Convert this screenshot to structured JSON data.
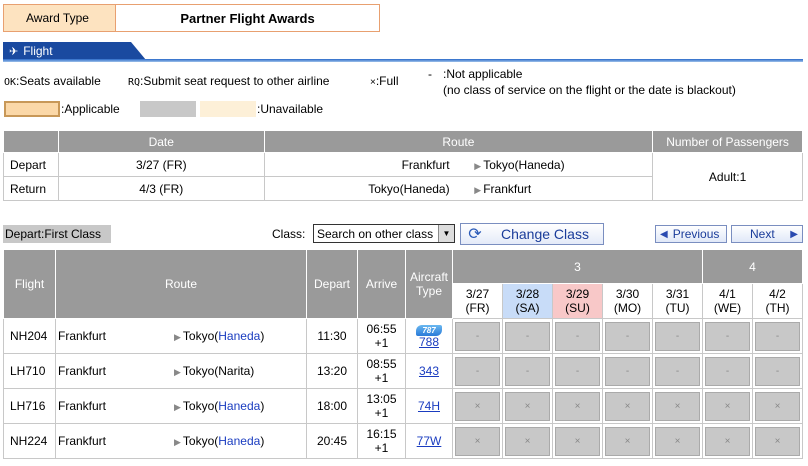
{
  "award": {
    "label": "Award Type",
    "value": "Partner Flight Awards"
  },
  "section": {
    "flight_tab": "Flight"
  },
  "legend": {
    "ok_code": "OK",
    "ok_text": ":Seats available",
    "rq_code": "RQ",
    "rq_text": ":Submit seat request to other airline",
    "full_code": "×",
    "full_text": ":Full",
    "na_code": "-",
    "na_text": ":Not applicable",
    "na_note": "(no class of service on the flight or the date is blackout)",
    "applicable": ":Applicable",
    "unavailable": ":Unavailable",
    "colors": {
      "applicable": "#fbd8a8",
      "unavailable_gray": "#c8c8c8",
      "unavailable_cream": "#fdf0d8"
    }
  },
  "summary": {
    "headers": {
      "date": "Date",
      "route": "Route",
      "passengers": "Number of Passengers"
    },
    "depart": {
      "label": "Depart",
      "date": "3/27 (FR)",
      "from": "Frankfurt",
      "to": "Tokyo(Haneda)"
    },
    "return": {
      "label": "Return",
      "date": "4/3 (FR)",
      "from": "Tokyo(Haneda)",
      "to": "Frankfurt"
    },
    "passengers": "Adult:1"
  },
  "controls": {
    "depart_label": "Depart:First Class",
    "class_label": "Class:",
    "class_value": "Search on other class",
    "change_class": "Change Class",
    "previous": "Previous",
    "next": "Next"
  },
  "flights_table": {
    "headers": {
      "flight": "Flight",
      "route": "Route",
      "depart": "Depart",
      "arrive": "Arrive",
      "aircraft1": "Aircraft",
      "aircraft2": "Type",
      "month3": "3",
      "month4": "4"
    },
    "dates": [
      {
        "d": "3/27",
        "w": "(FR)"
      },
      {
        "d": "3/28",
        "w": "(SA)"
      },
      {
        "d": "3/29",
        "w": "(SU)"
      },
      {
        "d": "3/30",
        "w": "(MO)"
      },
      {
        "d": "3/31",
        "w": "(TU)"
      },
      {
        "d": "4/1",
        "w": "(WE)"
      },
      {
        "d": "4/2",
        "w": "(TH)"
      }
    ],
    "rows": [
      {
        "flight": "NH204",
        "from": "Frankfurt",
        "to_city": "Tokyo(",
        "to_airport": "Haneda",
        "to_close": ")",
        "depart": "11:30",
        "arrive": "06:55",
        "arrive_plus": "+1",
        "aircraft": "788",
        "badge": "787",
        "cells": [
          "-",
          "-",
          "-",
          "-",
          "-",
          "-",
          "-"
        ]
      },
      {
        "flight": "LH710",
        "from": "Frankfurt",
        "to_city": "Tokyo(",
        "to_airport": "Narita",
        "to_close": ")",
        "depart": "13:20",
        "arrive": "08:55",
        "arrive_plus": "+1",
        "aircraft": "343",
        "badge": "",
        "cells": [
          "-",
          "-",
          "-",
          "-",
          "-",
          "-",
          "-"
        ]
      },
      {
        "flight": "LH716",
        "from": "Frankfurt",
        "to_city": "Tokyo(",
        "to_airport": "Haneda",
        "to_close": ")",
        "depart": "18:00",
        "arrive": "13:05",
        "arrive_plus": "+1",
        "aircraft": "74H",
        "badge": "",
        "cells": [
          "×",
          "×",
          "×",
          "×",
          "×",
          "×",
          "×"
        ]
      },
      {
        "flight": "NH224",
        "from": "Frankfurt",
        "to_city": "Tokyo(",
        "to_airport": "Haneda",
        "to_close": ")",
        "depart": "20:45",
        "arrive": "16:15",
        "arrive_plus": "+1",
        "aircraft": "77W",
        "badge": "",
        "cells": [
          "×",
          "×",
          "×",
          "×",
          "×",
          "×",
          "×"
        ]
      }
    ]
  }
}
